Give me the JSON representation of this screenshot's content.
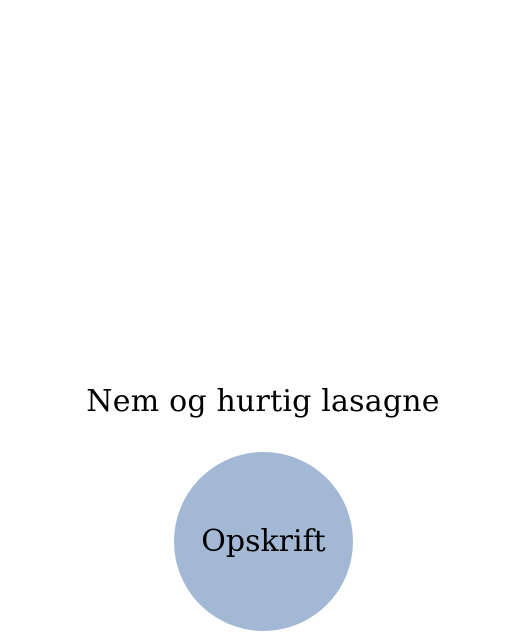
{
  "recipe": {
    "title": "Nem og hurtig lasagne",
    "button_label": "Opskrift"
  },
  "colors": {
    "button_background": "#a3b8d4",
    "text": "#000000"
  }
}
